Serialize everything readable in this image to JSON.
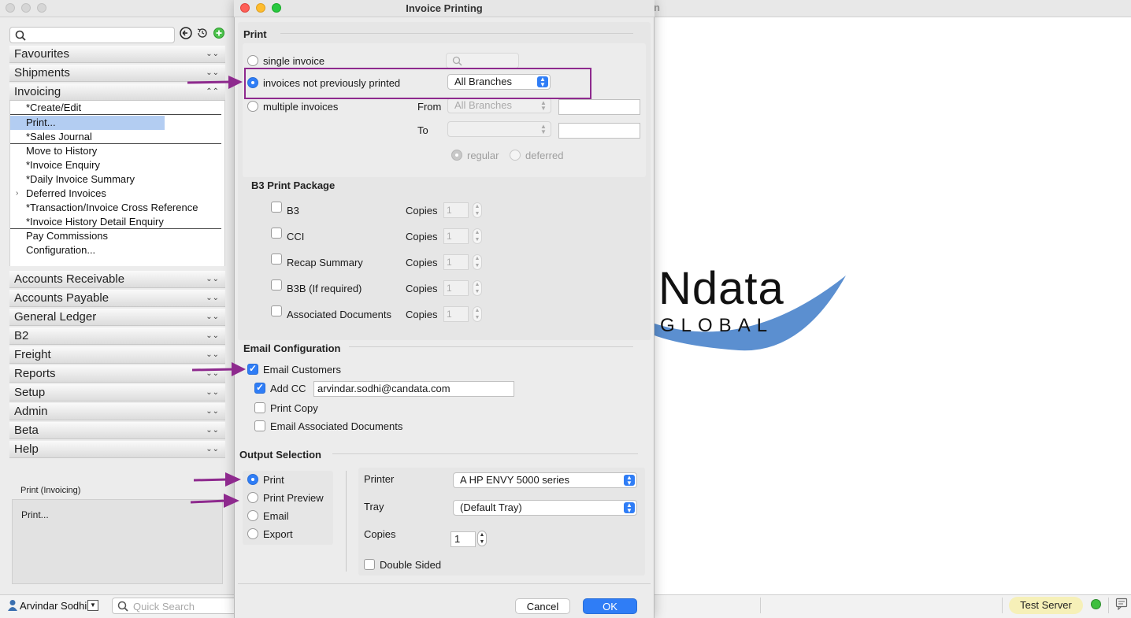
{
  "main_window": {
    "title_fragment": "n"
  },
  "sidebar": {
    "categories_top": [
      {
        "label": "Favourites"
      },
      {
        "label": "Shipments"
      },
      {
        "label": "Invoicing"
      }
    ],
    "invoicing_items": [
      {
        "label": "*Create/Edit"
      },
      {
        "label": "Print..."
      },
      {
        "label": "*Sales Journal"
      },
      {
        "label": "Move to History"
      },
      {
        "label": "*Invoice Enquiry"
      },
      {
        "label": "*Daily Invoice Summary"
      },
      {
        "label": "Deferred Invoices"
      },
      {
        "label": "*Transaction/Invoice Cross Reference"
      },
      {
        "label": "*Invoice History Detail Enquiry"
      },
      {
        "label": "Pay Commissions"
      },
      {
        "label": "Configuration..."
      }
    ],
    "categories_bottom": [
      {
        "label": "Accounts Receivable"
      },
      {
        "label": "Accounts Payable"
      },
      {
        "label": "General Ledger"
      },
      {
        "label": "B2"
      },
      {
        "label": "Freight"
      },
      {
        "label": "Reports"
      },
      {
        "label": "Setup"
      },
      {
        "label": "Admin"
      },
      {
        "label": "Beta"
      },
      {
        "label": "Help"
      }
    ],
    "status_title": "Print (Invoicing)",
    "status_text": "Print..."
  },
  "bottom_bar": {
    "user_name": "Arvindar Sodhi",
    "quick_search_placeholder": "Quick Search",
    "server_label": "Test Server"
  },
  "logo": {
    "main": "Ndata",
    "sub": "GLOBAL"
  },
  "dialog": {
    "title": "Invoice Printing",
    "print_section": {
      "title": "Print",
      "single_invoice": "single invoice",
      "not_previously_printed": "invoices not previously printed",
      "branch_select": "All Branches",
      "multiple_invoices": "multiple invoices",
      "from_label": "From",
      "from_branch": "All Branches",
      "to_label": "To",
      "regular": "regular",
      "deferred": "deferred"
    },
    "b3_package": {
      "title": "B3 Print Package",
      "copies_label": "Copies",
      "items": [
        {
          "label": "B3",
          "copies": "1"
        },
        {
          "label": "CCI",
          "copies": "1"
        },
        {
          "label": "Recap Summary",
          "copies": "1"
        },
        {
          "label": "B3B (If required)",
          "copies": "1"
        },
        {
          "label": "Associated Documents",
          "copies": "1"
        }
      ]
    },
    "email_config": {
      "title": "Email Configuration",
      "email_customers": "Email Customers",
      "add_cc": "Add CC",
      "cc_address": "arvindar.sodhi@candata.com",
      "print_copy": "Print Copy",
      "email_associated": "Email Associated Documents"
    },
    "output_selection": {
      "title": "Output Selection",
      "options": [
        "Print",
        "Print Preview",
        "Email",
        "Export"
      ],
      "printer_label": "Printer",
      "printer_value": "A HP ENVY 5000 series",
      "tray_label": "Tray",
      "tray_value": "(Default Tray)",
      "copies_label": "Copies",
      "copies_value": "1",
      "double_sided": "Double Sided"
    },
    "buttons": {
      "cancel": "Cancel",
      "ok": "OK"
    }
  },
  "colors": {
    "accent": "#2f7df6",
    "annotation": "#8e2a8e",
    "selection": "#b3cdf2",
    "logo_wave": "#5b8fd0"
  }
}
